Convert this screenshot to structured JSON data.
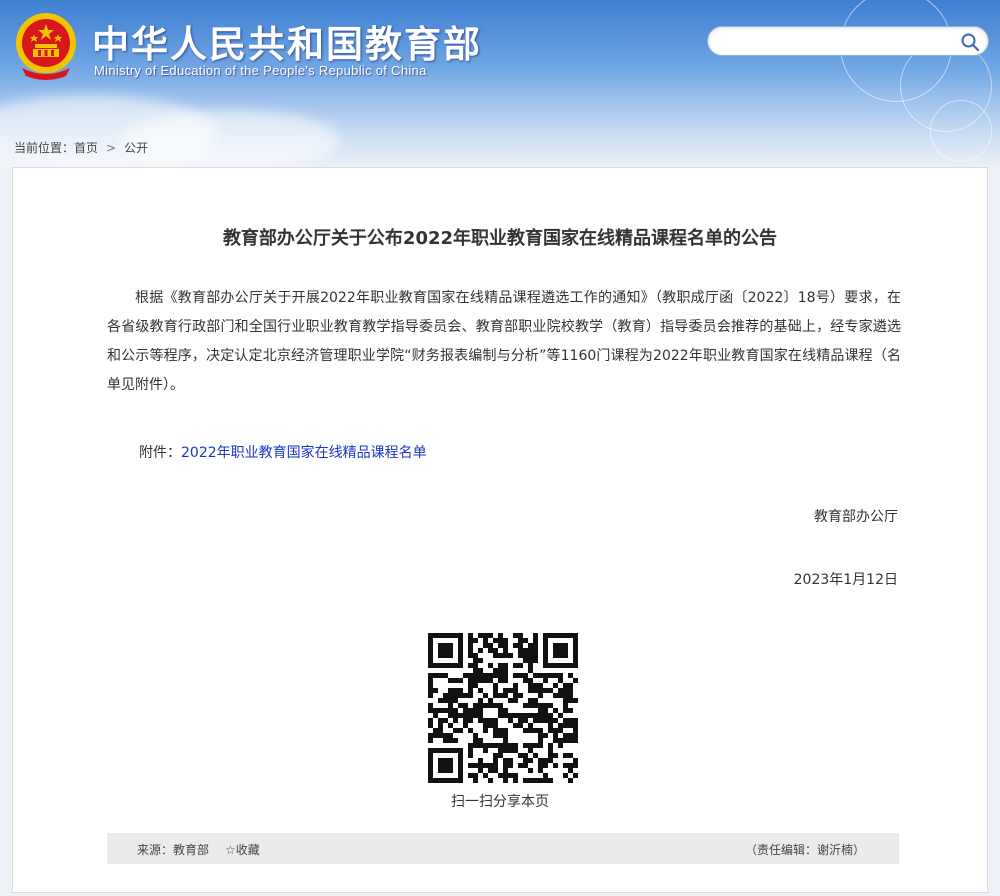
{
  "header": {
    "site_title": "中华人民共和国教育部",
    "site_subtitle": "Ministry of Education of the People's Republic of China",
    "search": {
      "placeholder": "",
      "icon": "search-icon"
    },
    "colors": {
      "sky_top": "#3f7fd2",
      "sky_bottom": "#eef2f8",
      "emblem_red": "#d9161c",
      "emblem_gold": "#f5c400"
    }
  },
  "breadcrumb": {
    "prefix": "当前位置：",
    "items": [
      "首页",
      "公开"
    ],
    "separator": ">"
  },
  "article": {
    "title": "教育部办公厅关于公布2022年职业教育国家在线精品课程名单的公告",
    "body": "根据《教育部办公厅关于开展2022年职业教育国家在线精品课程遴选工作的通知》（教职成厅函〔2022〕18号）要求，在各省级教育行政部门和全国行业职业教育教学指导委员会、教育部职业院校教学（教育）指导委员会推荐的基础上，经专家遴选和公示等程序，决定认定北京经济管理职业学院“财务报表编制与分析”等1160门课程为2022年职业教育国家在线精品课程（名单见附件）。",
    "attachment_label": "附件：",
    "attachment_link": "2022年职业教育国家在线精品课程名单",
    "signature": "教育部办公厅",
    "date": "2023年1月12日",
    "qr_caption": "扫一扫分享本页"
  },
  "footer": {
    "source": "来源：教育部",
    "favorite": "☆收藏",
    "editor": "（责任编辑：谢沂楠）"
  }
}
